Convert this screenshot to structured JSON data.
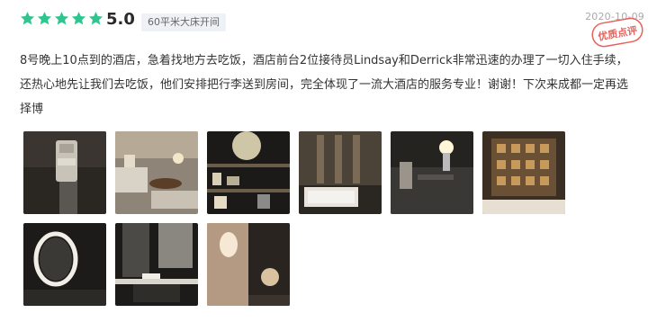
{
  "rating": {
    "stars": 5,
    "score": "5.0",
    "star_color": "#2ec58f"
  },
  "room_type": "60平米大床开间",
  "date": "2020-10-09",
  "badge": {
    "text": "优质点评",
    "color": "#e8605a"
  },
  "review_text": "8号晚上10点到的酒店，急着找地方去吃饭，酒店前台2位接待员Lindsay和Derrick非常迅速的办理了一切入住手续，还热心地先让我们去吃饭，他们安排把行李送到房间，完全体现了一流大酒店的服务专业！谢谢！下次来成都一定再选择博",
  "photos": [
    {
      "name": "photo-sculpture"
    },
    {
      "name": "photo-living-room"
    },
    {
      "name": "photo-vanity-shelf"
    },
    {
      "name": "photo-bathtub"
    },
    {
      "name": "photo-lamp-desk"
    },
    {
      "name": "photo-lattice-wall"
    },
    {
      "name": "photo-round-mirror"
    },
    {
      "name": "photo-corridor-sink"
    },
    {
      "name": "photo-wall-light"
    }
  ]
}
